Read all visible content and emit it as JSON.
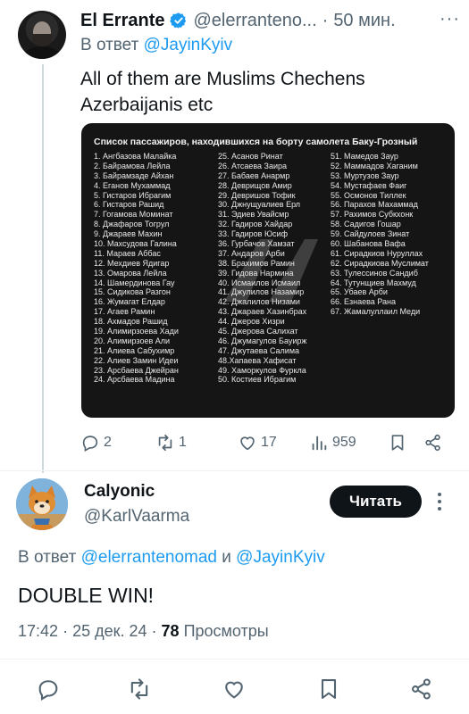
{
  "tweet": {
    "author_name": "El Errante",
    "author_handle": "@elerranteno...",
    "separator": "·",
    "time": "50 мин.",
    "more": "···",
    "reply_prefix": "В ответ",
    "reply_to": "@JayinKyiv",
    "text": "All of them are Muslims Chechens Azerbaijanis etc",
    "image": {
      "title": "Список пассажиров, находившихся на борту самолета Баку-Грозный",
      "columns": [
        [
          "1. Ангбазова Малайка",
          "2. Байрамова Лейла",
          "3. Байрамзаде Айхан",
          "4. Еганов Мухаммад",
          "5. Гистаров Ибрагим",
          "6. Гистаров Рашид",
          "7. Гогамова Моминат",
          "8. Джафаров Тогрул",
          "9. Джараев Махин",
          "10. Махсудова Галина",
          "11. Мараев Аббас",
          "12. Мехдиев Ядигар",
          "13. Омарова Лейла",
          "14. Шамердинова Гау",
          "15. Сидикова Разгон",
          "16. Жумагат Елдар",
          "17. Агаев Рамин",
          "18. Ахмадов Рашид",
          "19. Алимирзоева Хади",
          "20. Алимирзоев Али",
          "21. Алиева Сабухимр",
          "22. Алиев Замин Идеи",
          "23. Арсбаева Джейран",
          "24. Арсбаева Мадина"
        ],
        [
          "25. Асанов Ринат",
          "26. Атсаева Заира",
          "27. Бабаев Анармр",
          "28. Деврищов Амир",
          "29. Девришов Тофик",
          "30. Джнущуалиев Ерл",
          "31. Эдиев Увайсмр",
          "32. Гадиров Хайдар",
          "33. Гадиров Юсиф",
          "36. Гурбачов Хамзат",
          "37. Андаров Арби",
          "38. Брахимов Рамин",
          "39. Гидова Нармина",
          "40. Исмаилов Исмаил",
          "41. Джулилов Назамир",
          "42. Джалилов Низами",
          "43. Джараев Хазинбрах",
          "44. Джеров Хизри",
          "45. Джерова Салихат",
          "46. Джумагулов Бауирж",
          "47. Джутаева Салима",
          "48.Хапаева Хафисат",
          "49. Хаморкулов Фуркла",
          "50. Костиев Ибрагим"
        ],
        [
          "51. Мамедов Заур",
          "52. Маммадов Хаганим",
          "53. Муртузов Заур",
          "54. Мустафаев Фаиг",
          "55. Осмонов Тиллек",
          "56. Парахов Махаммад",
          "57. Рахимов Субкхонк",
          "58. Садигов Гошар",
          "59. Сайдулоев Зинат",
          "60. Шабанова Вафа",
          "61. Сирадкиов Нуруллах",
          "62. Сирадкиова Муслимат",
          "63. Тулессинов Сандиб",
          "64. Тутунщиев Махмуд",
          "65. Убаев Арби",
          "66. Езнаева Рана",
          "67. Жамалуллаил Меди"
        ]
      ]
    },
    "actions": {
      "reply_count": "2",
      "retweet_count": "1",
      "like_count": "17",
      "view_count": "959"
    }
  },
  "reply": {
    "author_name": "Calyonic",
    "author_handle": "@KarlVaarma",
    "follow_label": "Читать",
    "reply_prefix": "В ответ",
    "reply_to_1": "@elerrantenomad",
    "reply_join": "и",
    "reply_to_2": "@JayinKyiv",
    "text": "DOUBLE WIN!",
    "time": "17:42",
    "date": "25 дек. 24",
    "views": "78",
    "views_label": "Просмотры"
  },
  "colors": {
    "accent": "#1d9bf0",
    "secondary_text": "#536471",
    "primary_text": "#0f1419"
  }
}
